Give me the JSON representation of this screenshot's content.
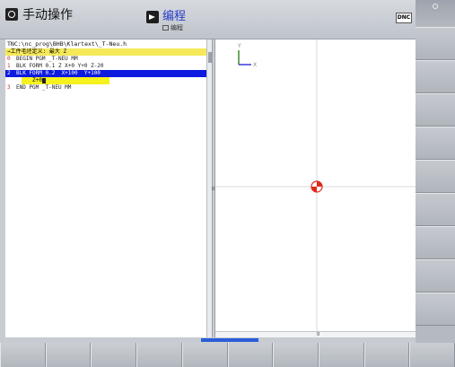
{
  "header": {
    "mode_label": "手动操作",
    "program_title": "编程",
    "program_sub": "编程",
    "dnc_label": "DNC"
  },
  "program": {
    "path": "TNC:\\nc_prog\\BHB\\Klartext\\_T-Neu.h",
    "prompt": "→工件毛坯定义: 最大 Z",
    "lines": [
      {
        "num": "0",
        "text": "BEGIN PGM _T-NEU MM"
      },
      {
        "num": "1",
        "text": "BLK FORM 0.1 Z X+0 Y+0 Z-20"
      },
      {
        "num": "2",
        "text": "BLK FORM 0.2  X+100  Y+100"
      },
      {
        "num": "3",
        "text": "END PGM _T-NEU MM"
      }
    ],
    "edit_value": "Z+0"
  },
  "graphics": {
    "axis_y": "Y",
    "axis_x": "X",
    "ruler_zero": "0",
    "splitter_zero": "0"
  },
  "colors": {
    "selection": "#0d1ae0",
    "prompt_bg": "#f5e95a",
    "edit_bg": "#f6f21e",
    "marker_red": "#e02a1a"
  },
  "icons": {
    "mode": "manual-operation-icon",
    "program": "program-run-icon",
    "datum": "datum-marker-icon"
  }
}
